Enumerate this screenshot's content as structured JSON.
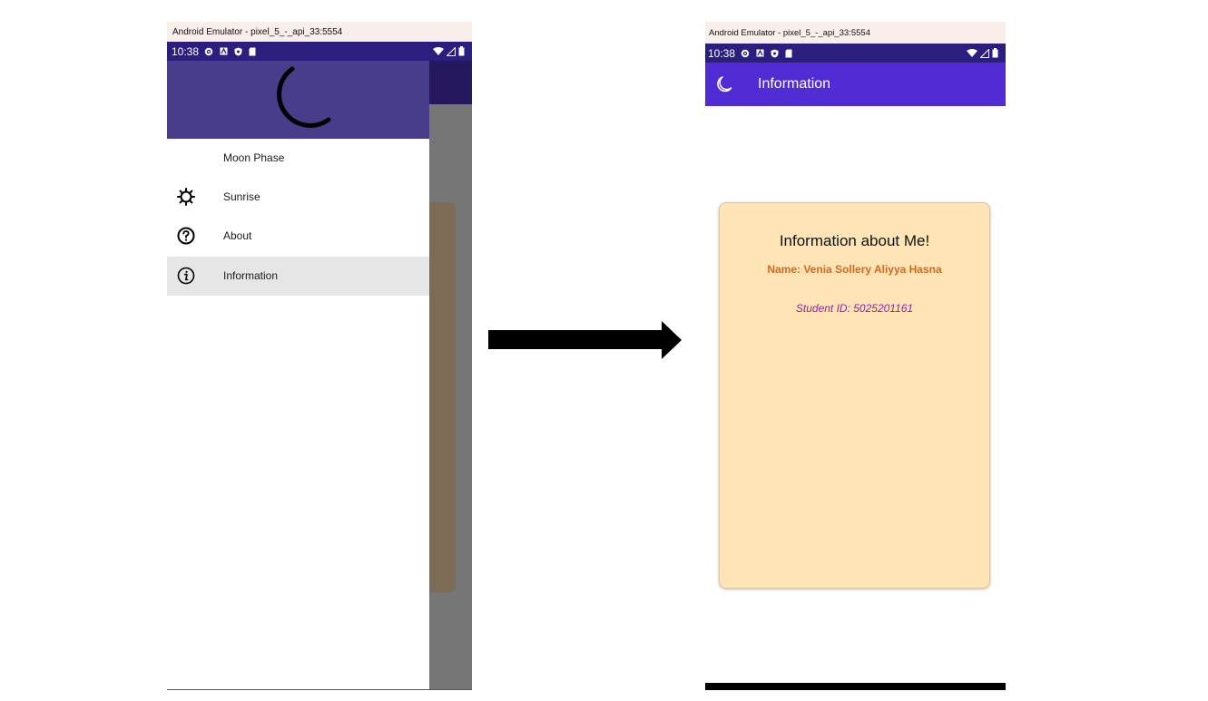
{
  "left_phone": {
    "window_title": "Android Emulator - pixel_5_-_api_33:5554",
    "status_time": "10:38",
    "drawer": {
      "header_icon": "moon-icon",
      "items": [
        {
          "label": "Moon Phase",
          "icon": "none",
          "selected": false
        },
        {
          "label": "Sunrise",
          "icon": "sun-icon",
          "selected": false
        },
        {
          "label": "About",
          "icon": "question-circle-icon",
          "selected": false
        },
        {
          "label": "Information",
          "icon": "info-circle-icon",
          "selected": true
        }
      ]
    }
  },
  "arrow": {
    "icon": "right-arrow-icon"
  },
  "right_phone": {
    "window_title": "Android Emulator - pixel_5_-_api_33:5554",
    "status_time": "10:38",
    "appbar_title": "Information",
    "card": {
      "title": "Information about Me!",
      "name": "Name: Venia Sollery Aliyya Hasna",
      "student_id": "Student ID: 5025201161"
    }
  },
  "colors": {
    "status_bar": "#2a1f7f",
    "drawer_header": "#483d8b",
    "app_bar": "#512bd4",
    "card_bg": "#ffe4b5",
    "name_text": "#d2691e",
    "id_text": "#8e24aa",
    "selected_item_bg": "#e6e6e6"
  }
}
